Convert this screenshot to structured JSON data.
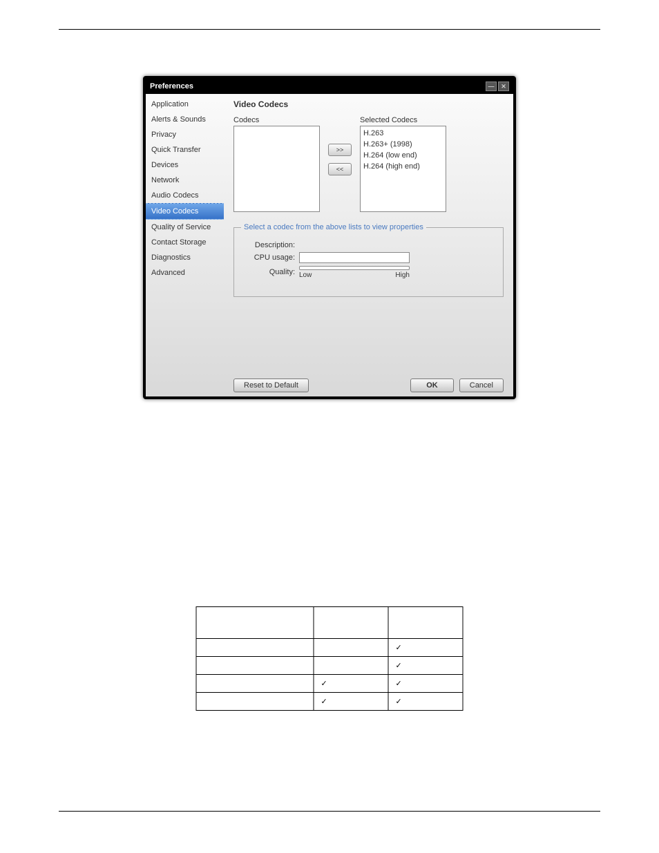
{
  "dialog": {
    "title": "Preferences",
    "sidebar": [
      "Application",
      "Alerts & Sounds",
      "Privacy",
      "Quick Transfer",
      "Devices",
      "Network",
      "Audio Codecs",
      "Video Codecs",
      "Quality of Service",
      "Contact Storage",
      "Diagnostics",
      "Advanced"
    ],
    "selected_index": 7,
    "main": {
      "heading": "Video Codecs",
      "codecs_label": "Codecs",
      "selected_label": "Selected Codecs",
      "selected_codecs": [
        "H.263",
        "H.263+ (1998)",
        "H.264 (low end)",
        "H.264 (high end)"
      ],
      "move_right": ">>",
      "move_left": "<<",
      "props_legend": "Select a codec from the above lists to view properties",
      "desc_label": "Description:",
      "cpu_label": "CPU usage:",
      "quality_label": "Quality:",
      "low": "Low",
      "high": "High"
    },
    "buttons": {
      "reset": "Reset to Default",
      "ok": "OK",
      "cancel": "Cancel"
    },
    "window_buttons": {
      "min": "—",
      "close": "✕"
    }
  },
  "table": {
    "headers": [
      "",
      "",
      ""
    ],
    "rows": [
      {
        "name": "",
        "c1": "",
        "c2": "✓"
      },
      {
        "name": "",
        "c1": "",
        "c2": "✓"
      },
      {
        "name": "",
        "c1": "✓",
        "c2": "✓"
      },
      {
        "name": "",
        "c1": "✓",
        "c2": "✓"
      }
    ]
  }
}
